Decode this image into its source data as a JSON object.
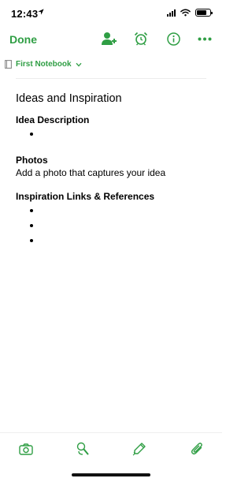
{
  "status_bar": {
    "time": "12:43",
    "battery_level": 0.75
  },
  "nav": {
    "done_label": "Done"
  },
  "notebook": {
    "name": "First Notebook"
  },
  "note": {
    "title": "Ideas and Inspiration",
    "sections": [
      {
        "heading": "Idea Description",
        "bullets": [
          ""
        ]
      },
      {
        "heading": "Photos",
        "text": "Add a photo that captures your idea"
      },
      {
        "heading": "Inspiration Links & References",
        "bullets": [
          "",
          "",
          ""
        ]
      }
    ]
  },
  "toolbar_icons": [
    "camera-icon",
    "microphone-icon",
    "pen-icon",
    "paperclip-icon"
  ],
  "colors": {
    "accent": "#2f9e44",
    "text": "#000000",
    "divider": "#ececec"
  }
}
